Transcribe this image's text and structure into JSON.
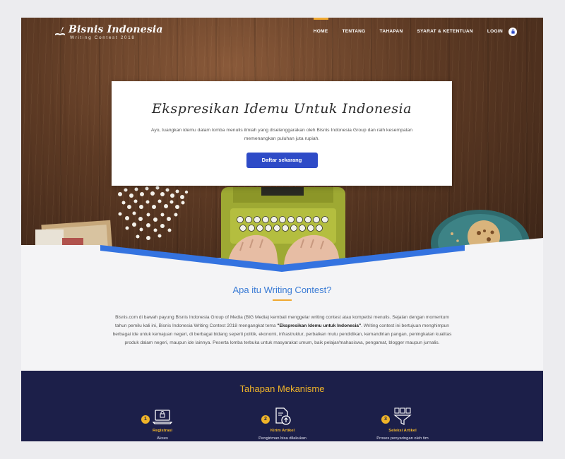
{
  "header": {
    "logo_name": "Bisnis Indonesia",
    "logo_tagline": "Writing Contest 2018",
    "nav": [
      {
        "label": "HOME",
        "active": true
      },
      {
        "label": "TENTANG",
        "active": false
      },
      {
        "label": "TAHAPAN",
        "active": false
      },
      {
        "label": "SYARAT & KETENTUAN",
        "active": false
      },
      {
        "label": "LOGIN",
        "active": false
      }
    ],
    "login_icon": "lock-icon"
  },
  "hero": {
    "title": "Ekspresikan Idemu Untuk Indonesia",
    "subtitle": "Ayo, tuangkan idemu dalam lomba menulis ilmiah yang diselenggarakan oleh Bisnis Indonesia Group dan raih kesempatan memenangkan puluhan juta rupiah.",
    "cta_label": "Daftar sekarang"
  },
  "about": {
    "heading": "Apa itu Writing Contest?",
    "body_before": "Bisnis.com di bawah payung Bisnis Indonesia Group of Media (BIG Media) kembali menggelar writing contest atau kompetisi menulis. Sejalan dengan momentum tahun pemilu kali ini, Bisnis Indonesia Writing Contest 2018 mengangkat tema ",
    "body_theme": "\"Ekspresikan Idemu untuk Indonesia\"",
    "body_after": ". Writing contest ini bertujuan menghimpun berbagai ide untuk kemajuan negeri, di berbagai bidang seperti politik, ekonomi, infrastruktur, perbaikan mutu pendidikan, kemandirian pangan, peningkatan kualitas produk dalam negeri, maupun ide lainnya. Peserta lomba terbuka untuk masyarakat umum, baik pelajar/mahasiswa, pengamat, blogger maupun jurnalis."
  },
  "mechanism": {
    "heading": "Tahapan Mekanisme",
    "steps": [
      {
        "num": "1",
        "icon": "laptop-lock-icon",
        "title": "Registrasi",
        "desc": "Akses"
      },
      {
        "num": "2",
        "icon": "document-upload-icon",
        "title": "Kirim Artikel",
        "desc": "Pengiriman bisa dilakukan"
      },
      {
        "num": "3",
        "icon": "filter-documents-icon",
        "title": "Seleksi Artikel",
        "desc": "Proses penyaringan oleh tim"
      }
    ]
  },
  "colors": {
    "accent_blue": "#2e4bc7",
    "heading_blue": "#3a7bd5",
    "gold": "#f0b429",
    "navy": "#1c1f49"
  }
}
